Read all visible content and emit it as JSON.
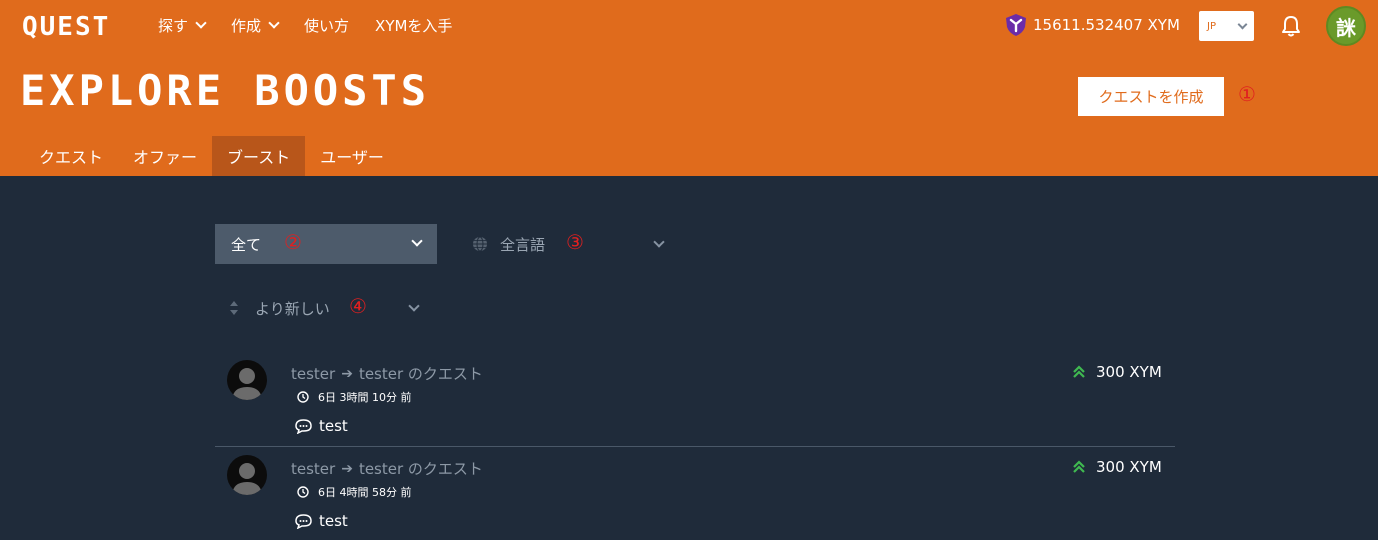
{
  "header": {
    "logo": "QUEST",
    "nav": [
      {
        "label": "探す"
      },
      {
        "label": "作成"
      },
      {
        "label": "使い方"
      },
      {
        "label": "XYMを入手"
      }
    ],
    "balance": "15611.532407 XYM",
    "language": "JP",
    "avatar_text": "詸"
  },
  "page": {
    "title": "EXPLORE BOOSTS",
    "create_button": "クエストを作成",
    "tabs": [
      "クエスト",
      "オファー",
      "ブースト",
      "ユーザー"
    ],
    "active_tab": "ブースト"
  },
  "markers": {
    "m1": "①",
    "m2": "②",
    "m3": "③",
    "m4": "④"
  },
  "filters": {
    "category": "全て",
    "language": "全言語",
    "sort": "より新しい"
  },
  "boosts": [
    {
      "from": "tester",
      "to": "tester のクエスト",
      "time": "6日 3時間 10分 前",
      "message": "test",
      "amount": "300 XYM"
    },
    {
      "from": "tester",
      "to": "tester のクエスト",
      "time": "6日 4時間 58分 前",
      "message": "test",
      "amount": "300 XYM"
    }
  ],
  "colors": {
    "header_bg": "#e06b1c",
    "page_bg": "#1f2b3a",
    "active_tab": "#b8561a",
    "boost_green": "#3fb950",
    "marker_red": "#e02020"
  }
}
